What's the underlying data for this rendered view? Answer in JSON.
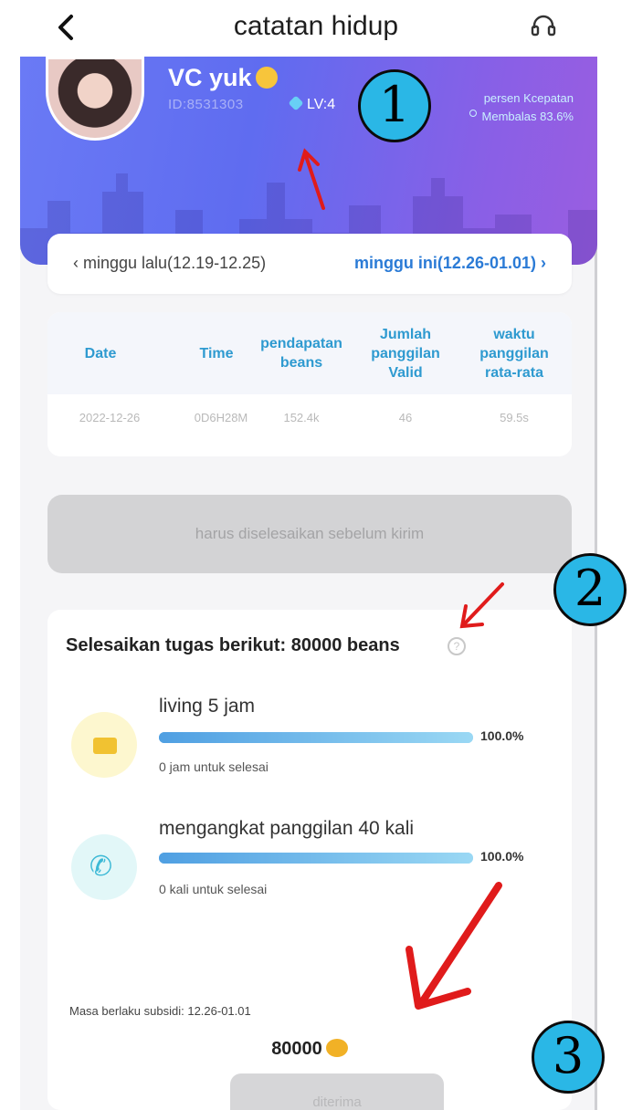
{
  "nav": {
    "title": "catatan hidup"
  },
  "profile": {
    "name": "VC yuk",
    "id_text": "ID:8531303",
    "level": "LV:4",
    "speed_label": "persen Kcepatan",
    "speed_value": "Membalas 83.6%"
  },
  "week": {
    "prev_label": "‹ minggu lalu(12.19-12.25)",
    "next_label": "minggu ini(12.26-01.01) ›"
  },
  "table": {
    "headers": [
      "Date",
      "Time",
      "pendapatan beans",
      "Jumlah panggilan Valid",
      "waktu panggilan rata-rata"
    ],
    "rows": [
      [
        "2022-12-26",
        "0D6H28M",
        "152.4k",
        "46",
        "59.5s"
      ]
    ]
  },
  "submit_bar": {
    "label": "harus diselesaikan sebelum kirim"
  },
  "tasks": {
    "title": "Selesaikan tugas berikut: 80000 beans",
    "help_glyph": "?",
    "items": [
      {
        "icon": "box-icon",
        "name": "living 5 jam",
        "progress": 1.0,
        "percent": "100.0%",
        "remaining": "0 jam untuk selesai"
      },
      {
        "icon": "phone-icon",
        "name": "mengangkat panggilan 40 kali",
        "progress": 1.0,
        "percent": "100.0%",
        "remaining": "0 kali untuk selesai"
      }
    ],
    "validity": "Masa berlaku subsidi: 12.26-01.01",
    "reward_amount": "80000",
    "accept_label": "diterima"
  },
  "annotations": {
    "badge_1": "1",
    "badge_2": "2",
    "badge_3": "3",
    "arrow_color": "#e01b1b",
    "badge_color": "#2ab7e6"
  }
}
